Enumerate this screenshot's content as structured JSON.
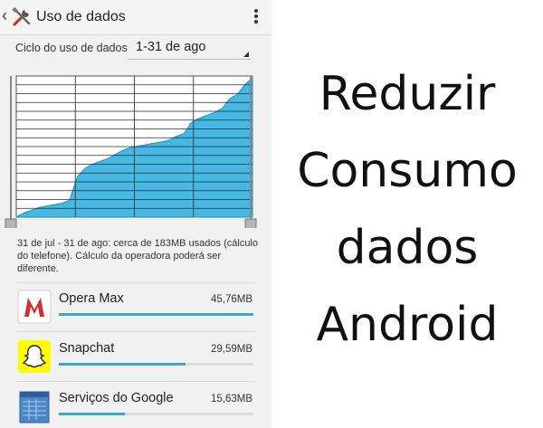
{
  "header": {
    "title": "Uso de dados",
    "back_icon": "chevron-left-icon",
    "app_icon": "tools-icon",
    "menu_icon": "overflow-menu-icon"
  },
  "cycle": {
    "label": "Ciclo do uso de dados",
    "value": "1-31 de ago"
  },
  "summary": "31 de jul - 31 de ago: cerca de 183MB  usados (cálculo do telefone). Cálculo da operadora poderá ser diferente.",
  "apps": [
    {
      "name": "Opera Max",
      "size": "45,76MB",
      "share": 1.0,
      "icon": "opera-max-icon"
    },
    {
      "name": "Snapchat",
      "size": "29,59MB",
      "share": 0.65,
      "icon": "snapchat-ghost-icon"
    },
    {
      "name": "Serviços do Google",
      "size": "15,63MB",
      "share": 0.34,
      "icon": "google-services-icon"
    }
  ],
  "chart_data": {
    "type": "area",
    "x": [
      0,
      1,
      2,
      3,
      4,
      5,
      6,
      7,
      8,
      9,
      10,
      11,
      12,
      13,
      14,
      15,
      16,
      17,
      18,
      19,
      20,
      21,
      22,
      23,
      24,
      25,
      26,
      27,
      28,
      29,
      30,
      31
    ],
    "values": [
      0,
      3,
      5,
      7,
      8,
      9,
      10,
      12,
      29,
      35,
      38,
      40,
      42,
      45,
      48,
      50,
      51,
      52,
      53,
      54,
      55,
      58,
      60,
      68,
      71,
      73,
      75,
      78,
      85,
      88,
      95,
      100
    ],
    "ylim": [
      0,
      100
    ],
    "grid": true,
    "fill_color": "#45b9e4",
    "line_color": "#1f8fc0"
  },
  "promo": {
    "lines": [
      "Reduzir",
      "Consumo",
      "dados",
      "Android"
    ]
  }
}
